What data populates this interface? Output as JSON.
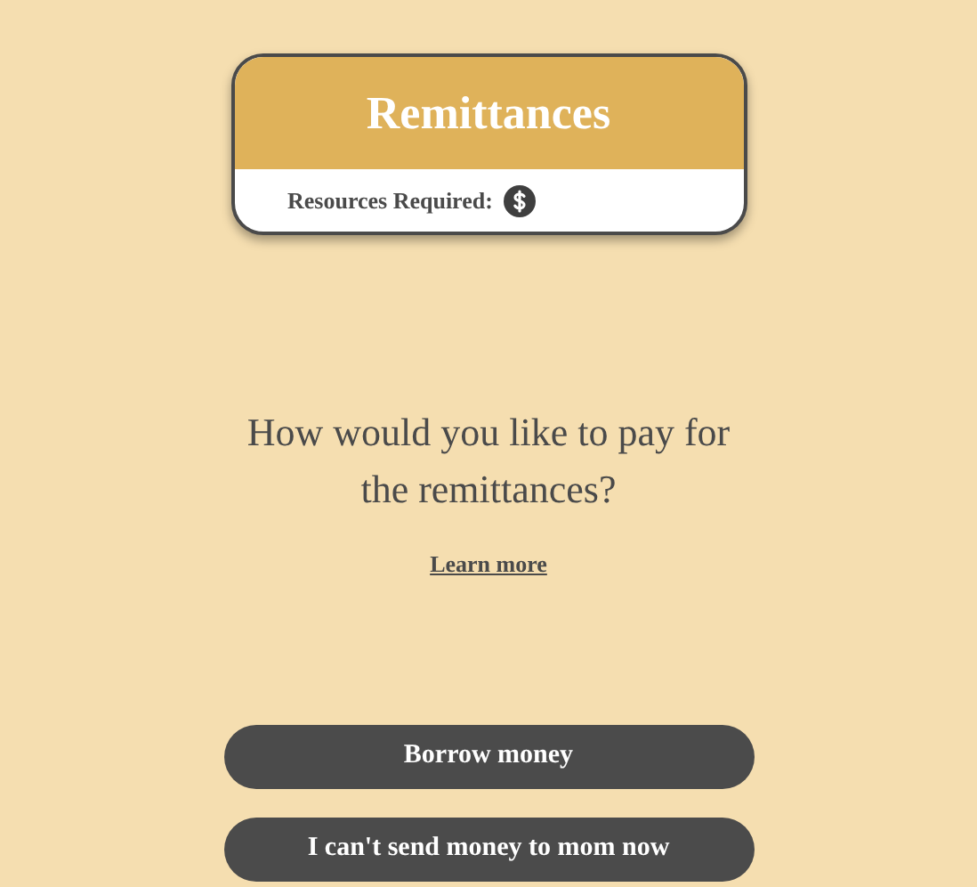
{
  "card": {
    "title": "Remittances",
    "resources_label": "Resources Required:",
    "resources": [
      {
        "kind": "money"
      }
    ]
  },
  "question": "How would you like to pay for the remittances?",
  "learn_more": "Learn more",
  "options": [
    {
      "label": "Borrow money"
    },
    {
      "label": "I can't send money to mom now"
    }
  ]
}
